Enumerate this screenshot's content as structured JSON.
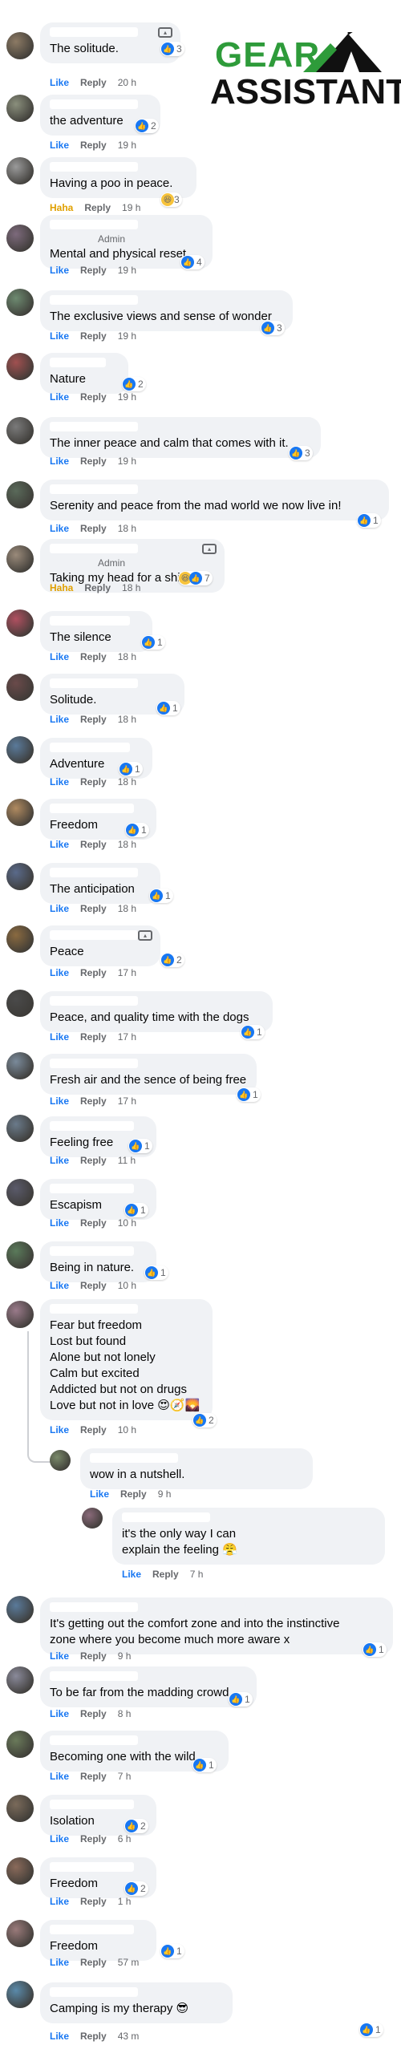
{
  "logo": {
    "line1": "GEAR",
    "line2": "ASSISTANT"
  },
  "labels": {
    "like": "Like",
    "reply": "Reply",
    "haha": "Haha",
    "admin": "Admin"
  },
  "colors": {
    "like_blue": "#1877f2",
    "haha_yellow": "#f7c33b",
    "bubble_bg": "#f0f2f5",
    "brand_green": "#2e9b3a"
  },
  "comments": [
    {
      "text": "The solitude.",
      "reaction": "like",
      "time": "20 h",
      "react_icons": "like",
      "react_count": "3",
      "badge": true
    },
    {
      "text": "the adventure",
      "reaction": "like",
      "time": "19 h",
      "react_icons": "like",
      "react_count": "2"
    },
    {
      "text": "Having a poo in peace.",
      "reaction": "haha",
      "time": "19 h",
      "react_icons": "haha",
      "react_count": "3"
    },
    {
      "text": "Mental and physical reset.",
      "reaction": "like",
      "time": "19 h",
      "react_icons": "like",
      "react_count": "4",
      "admin": true
    },
    {
      "text": "The exclusive views and sense of wonder",
      "reaction": "like",
      "time": "19 h",
      "react_icons": "like",
      "react_count": "3"
    },
    {
      "text": "Nature",
      "reaction": "like",
      "time": "19 h",
      "react_icons": "like",
      "react_count": "2"
    },
    {
      "text": "The inner peace and calm that comes with it.",
      "reaction": "like",
      "time": "19 h",
      "react_icons": "like",
      "react_count": "3"
    },
    {
      "text": "Serenity and peace from the mad world we now live in!",
      "reaction": "like",
      "time": "18 h",
      "react_icons": "like",
      "react_count": "1"
    },
    {
      "text": "Taking my head for a shit",
      "reaction": "haha",
      "time": "18 h",
      "react_icons": "haha-like",
      "react_count": "7",
      "admin": true,
      "badge": true
    },
    {
      "text": "The silence",
      "reaction": "like",
      "time": "18 h",
      "react_icons": "like",
      "react_count": "1"
    },
    {
      "text": "Solitude.",
      "reaction": "like",
      "time": "18 h",
      "react_icons": "like",
      "react_count": "1"
    },
    {
      "text": "Adventure",
      "reaction": "like",
      "time": "18 h",
      "react_icons": "like",
      "react_count": "1"
    },
    {
      "text": "Freedom",
      "reaction": "like",
      "time": "18 h",
      "react_icons": "like",
      "react_count": "1"
    },
    {
      "text": "The anticipation",
      "reaction": "like",
      "time": "18 h",
      "react_icons": "like",
      "react_count": "1"
    },
    {
      "text": "Peace",
      "reaction": "like",
      "time": "17 h",
      "react_icons": "like",
      "react_count": "2",
      "badge": true
    },
    {
      "text": "Peace, and quality time with the dogs",
      "reaction": "like",
      "time": "17 h",
      "react_icons": "like",
      "react_count": "1"
    },
    {
      "text": "Fresh air and the sence of being free",
      "reaction": "like",
      "time": "17 h",
      "react_icons": "like",
      "react_count": "1"
    },
    {
      "text": "Feeling free",
      "reaction": "like",
      "time": "11 h",
      "react_icons": "like",
      "react_count": "1"
    },
    {
      "text": "Escapism",
      "reaction": "like",
      "time": "10 h",
      "react_icons": "like",
      "react_count": "1"
    },
    {
      "text": "Being in nature.",
      "reaction": "like",
      "time": "10 h",
      "react_icons": "like",
      "react_count": "1"
    },
    {
      "text": "Fear but freedom\nLost but found\nAlone but not lonely\nCalm but excited\nAddicted but not on drugs\nLove but not in love 😍🧭🌄",
      "reaction": "like",
      "time": "10 h",
      "react_icons": "like",
      "react_count": "2"
    },
    {
      "text": "wow in a nutshell.",
      "reaction": "like",
      "time": "9 h",
      "react_icons": "",
      "react_count": ""
    },
    {
      "text": "it's the only way I can\nexplain the feeling 😤",
      "reaction": "like",
      "time": "7 h",
      "react_icons": "",
      "react_count": ""
    },
    {
      "text": "It's getting out the comfort zone and into the instinctive\nzone where you become much more aware x",
      "reaction": "like",
      "time": "9 h",
      "react_icons": "like",
      "react_count": "1"
    },
    {
      "text": "To be far from the madding crowd.",
      "reaction": "like",
      "time": "8 h",
      "react_icons": "like",
      "react_count": "1"
    },
    {
      "text": "Becoming one with the wild.",
      "reaction": "like",
      "time": "7 h",
      "react_icons": "like",
      "react_count": "1"
    },
    {
      "text": "Isolation",
      "reaction": "like",
      "time": "6 h",
      "react_icons": "like",
      "react_count": "2"
    },
    {
      "text": "Freedom",
      "reaction": "like",
      "time": "1 h",
      "react_icons": "like",
      "react_count": "2"
    },
    {
      "text": "Freedom",
      "reaction": "like",
      "time": "57 m",
      "react_icons": "like",
      "react_count": "1"
    },
    {
      "text": "Camping is my therapy 😎",
      "reaction": "like",
      "time": "43 m",
      "react_icons": "like",
      "react_count": "1"
    }
  ]
}
